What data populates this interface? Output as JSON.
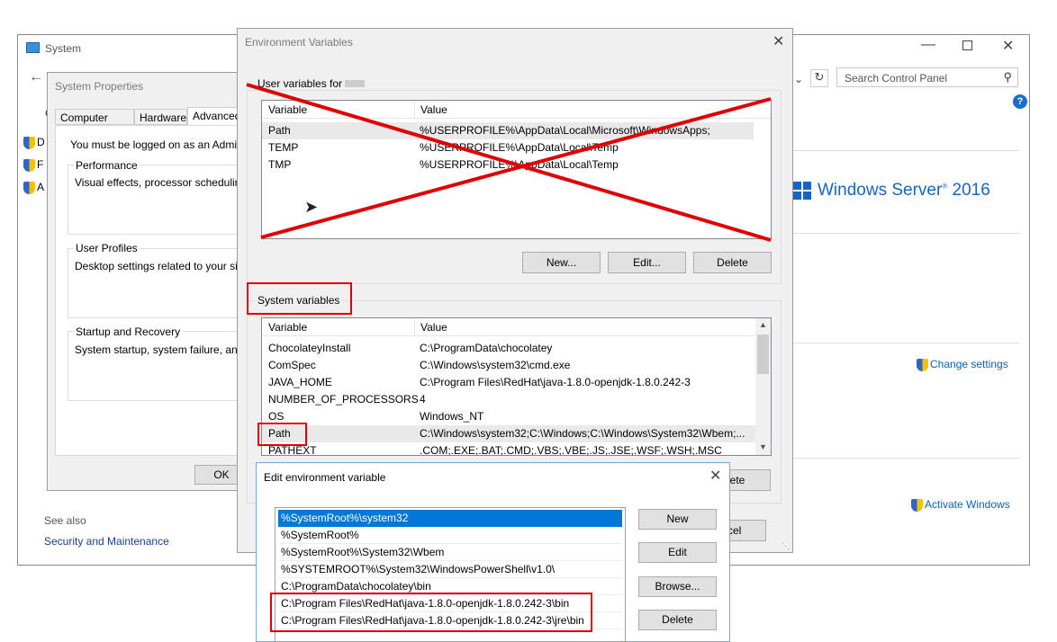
{
  "system_window": {
    "title": "System",
    "search_placeholder": "Search Control Panel",
    "windows_server_label": "Windows Server",
    "windows_server_version": "2016",
    "change_settings": "Change settings",
    "activate_windows": "Activate Windows",
    "see_also": "See also",
    "security_maintenance": "Security and Maintenance",
    "left_letters": [
      "D",
      "F",
      "A"
    ],
    "left_c": "C"
  },
  "system_properties": {
    "title": "System Properties",
    "tabs": [
      "Computer Name",
      "Hardware",
      "Advanced"
    ],
    "admin_note": "You must be logged on as an Administra",
    "groups": [
      {
        "label": "Performance",
        "text": "Visual effects, processor scheduling, m"
      },
      {
        "label": "User Profiles",
        "text": "Desktop settings related to your sign-in"
      },
      {
        "label": "Startup and Recovery",
        "text": "System startup, system failure, and deb"
      }
    ],
    "ok": "OK"
  },
  "env_vars": {
    "title": "Environment Variables",
    "user_group": "User variables for",
    "columns": [
      "Variable",
      "Value"
    ],
    "user_rows": [
      {
        "variable": "Path",
        "value": "%USERPROFILE%\\AppData\\Local\\Microsoft\\WindowsApps;"
      },
      {
        "variable": "TEMP",
        "value": "%USERPROFILE%\\AppData\\Local\\Temp"
      },
      {
        "variable": "TMP",
        "value": "%USERPROFILE%\\AppData\\Local\\Temp"
      }
    ],
    "user_buttons": [
      "New...",
      "Edit...",
      "Delete"
    ],
    "system_group": "System variables",
    "system_rows": [
      {
        "variable": "ChocolateyInstall",
        "value": "C:\\ProgramData\\chocolatey"
      },
      {
        "variable": "ComSpec",
        "value": "C:\\Windows\\system32\\cmd.exe"
      },
      {
        "variable": "JAVA_HOME",
        "value": "C:\\Program Files\\RedHat\\java-1.8.0-openjdk-1.8.0.242-3"
      },
      {
        "variable": "NUMBER_OF_PROCESSORS",
        "value": "4"
      },
      {
        "variable": "OS",
        "value": "Windows_NT"
      },
      {
        "variable": "Path",
        "value": "C:\\Windows\\system32;C:\\Windows;C:\\Windows\\System32\\Wbem;..."
      },
      {
        "variable": "PATHEXT",
        "value": ".COM;.EXE;.BAT;.CMD;.VBS;.VBE;.JS;.JSE;.WSF;.WSH;.MSC"
      }
    ],
    "system_delete_partial": "lete",
    "cancel_partial": "cel"
  },
  "edit_env": {
    "title": "Edit environment variable",
    "entries": [
      "%SystemRoot%\\system32",
      "%SystemRoot%",
      "%SystemRoot%\\System32\\Wbem",
      "%SYSTEMROOT%\\System32\\WindowsPowerShell\\v1.0\\",
      "C:\\ProgramData\\chocolatey\\bin",
      "C:\\Program Files\\RedHat\\java-1.8.0-openjdk-1.8.0.242-3\\bin",
      "C:\\Program Files\\RedHat\\java-1.8.0-openjdk-1.8.0.242-3\\jre\\bin"
    ],
    "buttons": [
      "New",
      "Edit",
      "Browse...",
      "Delete"
    ]
  },
  "colors": {
    "annotation_red": "#e00000",
    "selection_blue": "#0078d7",
    "link_blue": "#0b5fb8"
  }
}
